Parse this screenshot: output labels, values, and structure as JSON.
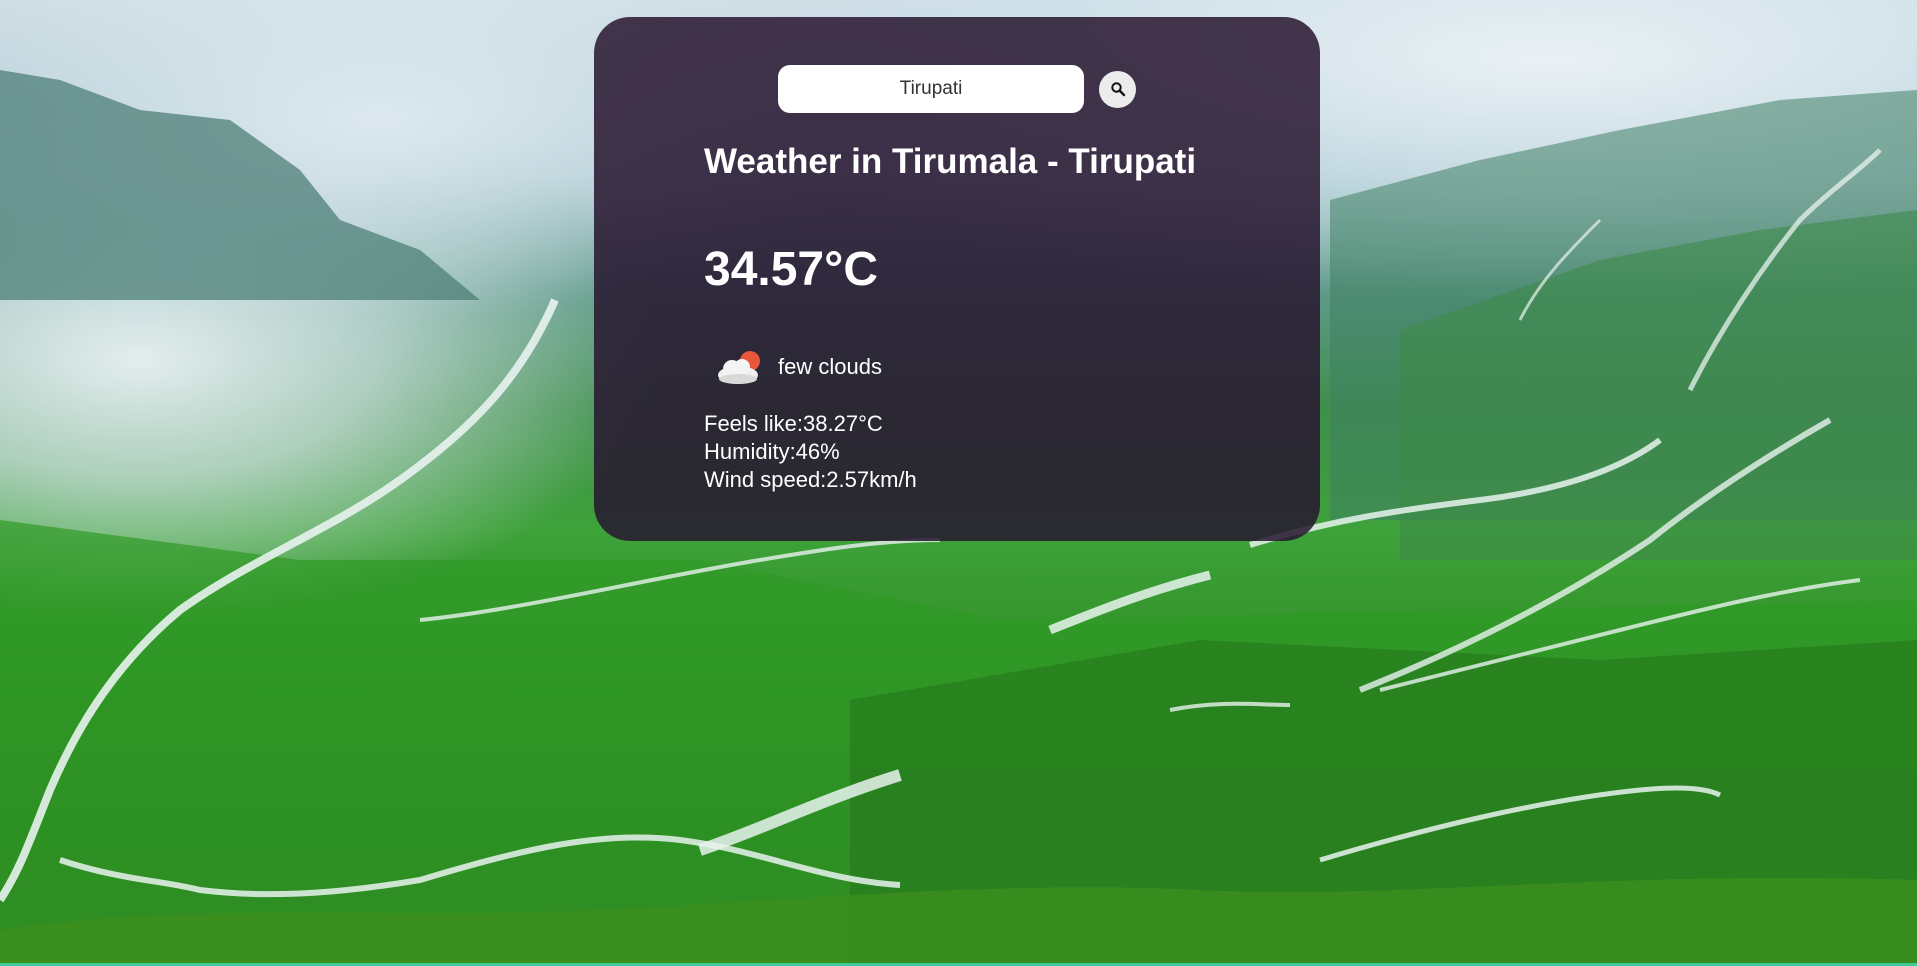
{
  "search": {
    "value": "Tirupati",
    "icon": "search-icon"
  },
  "weather": {
    "title": "Weather in Tirumala - Tirupati",
    "temperature": "34.57°C",
    "condition_icon": "few-clouds-icon",
    "condition": "few clouds",
    "feels_like": "Feels like:38.27°C",
    "humidity": "Humidity:46%",
    "wind_speed": "Wind speed:2.57km/h"
  },
  "colors": {
    "card_background": "#281630",
    "accent_line": "#3ec99a",
    "text": "#ffffff"
  }
}
